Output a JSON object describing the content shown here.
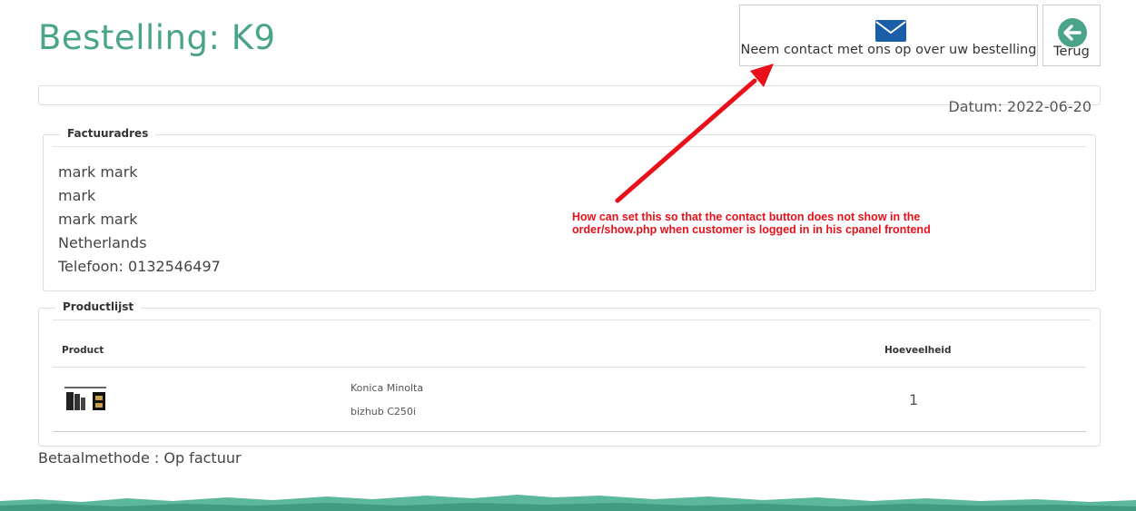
{
  "header": {
    "title": "Bestelling: K9",
    "contact_button_label": "Neem contact met ons op over uw bestelling",
    "back_button_label": "Terug"
  },
  "order": {
    "date_text": "Datum: 2022-06-20"
  },
  "billing": {
    "legend": "Factuuradres",
    "lines": [
      "mark mark",
      "mark",
      "mark mark",
      "Netherlands",
      "Telefoon: 0132546497"
    ]
  },
  "annotation": {
    "lines": [
      "How can set this so that the contact button does not show in the",
      "order/show.php when customer is logged in in his cpanel frontend"
    ],
    "color": "#e8101a"
  },
  "products": {
    "legend": "Productlijst",
    "columns": {
      "product": "Product",
      "quantity": "Hoeveelheid"
    },
    "rows": [
      {
        "name_line1": "Konica Minolta",
        "name_line2": "bizhub C250i",
        "quantity": "1"
      }
    ]
  },
  "payment": {
    "text": "Betaalmethode : Op factuur"
  },
  "colors": {
    "accent": "#4aa48a",
    "mail_icon": "#1a5ea8",
    "back_icon": "#4aa48a"
  },
  "icons": {
    "contact": "envelope-icon",
    "back": "arrow-left-circle-icon"
  }
}
